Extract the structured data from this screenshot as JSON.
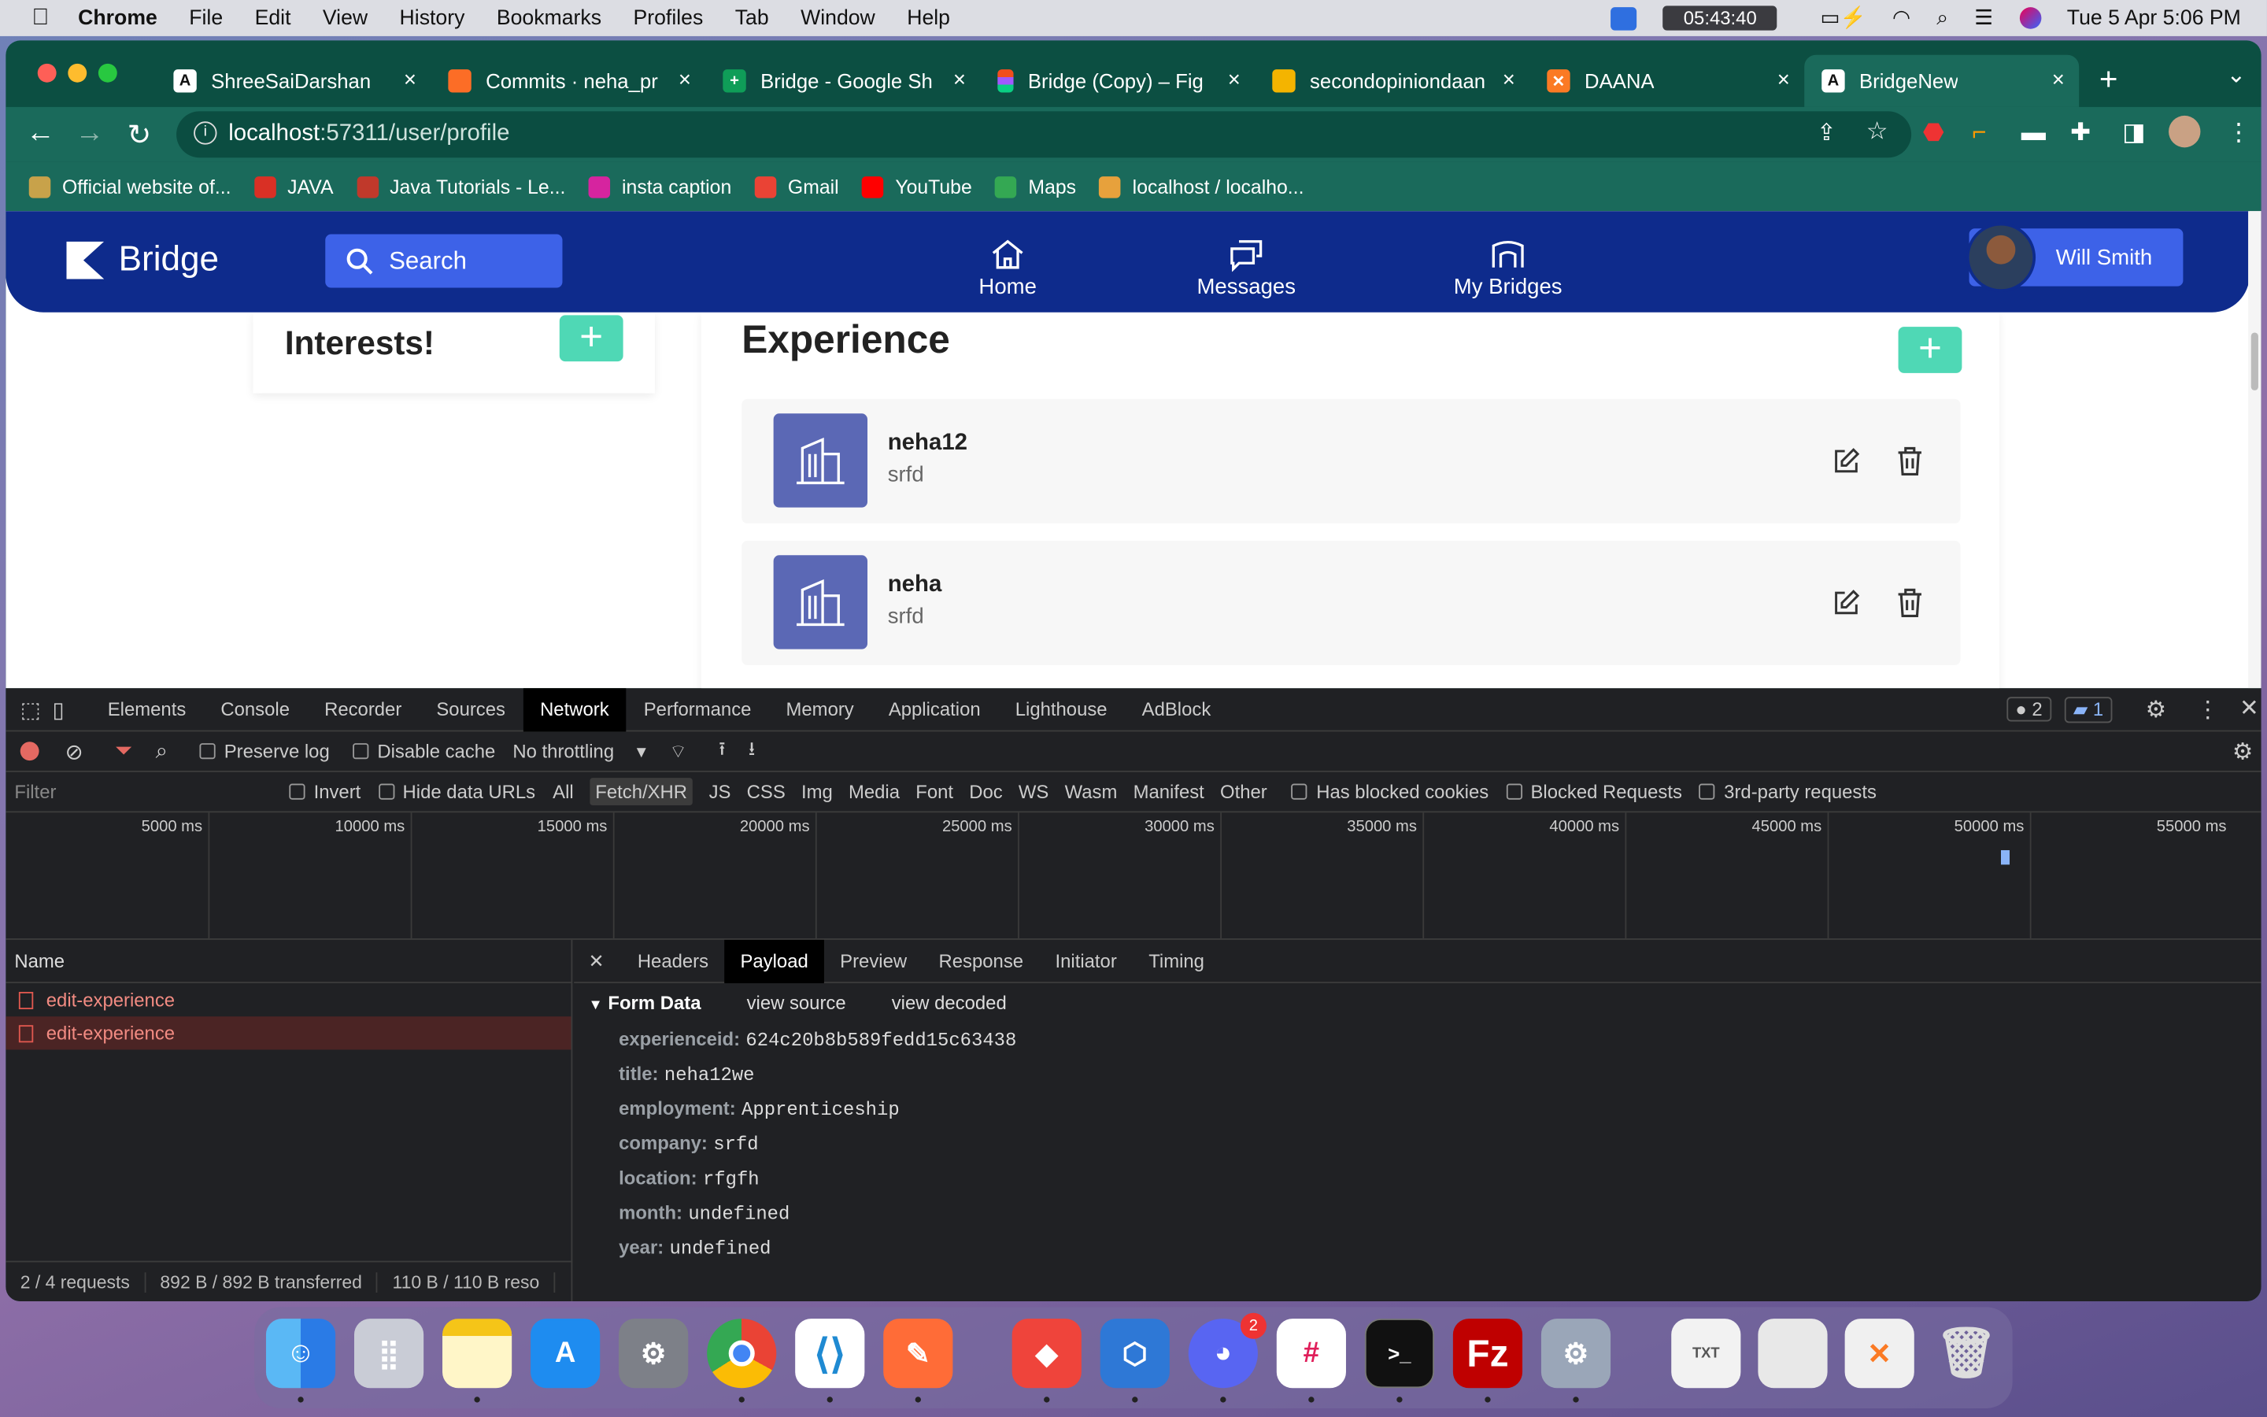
{
  "menubar": {
    "app": "Chrome",
    "items": [
      "File",
      "Edit",
      "View",
      "History",
      "Bookmarks",
      "Profiles",
      "Tab",
      "Window",
      "Help"
    ],
    "clock_badge": "05:43:40",
    "datetime": "Tue 5 Apr  5:06 PM"
  },
  "tabs": [
    {
      "title": "ShreeSaiDarshan",
      "icon": "angular-icon"
    },
    {
      "title": "Commits · neha_pr",
      "icon": "gitlab-icon"
    },
    {
      "title": "Bridge - Google Sh",
      "icon": "sheets-icon"
    },
    {
      "title": "Bridge (Copy) – Fig",
      "icon": "figma-icon"
    },
    {
      "title": "secondopiniondaan",
      "icon": "slides-icon"
    },
    {
      "title": "DAANA",
      "icon": "xampp-icon"
    },
    {
      "title": "BridgeNew",
      "icon": "angular-icon"
    }
  ],
  "address": {
    "host": "localhost",
    "path": ":57311/user/profile"
  },
  "bookmarks": [
    {
      "label": "Official website of...",
      "color": "#c8a24a"
    },
    {
      "label": "JAVA",
      "color": "#d93025"
    },
    {
      "label": "Java Tutorials - Le...",
      "color": "#c0392b"
    },
    {
      "label": "insta caption",
      "color": "#d6249f"
    },
    {
      "label": "Gmail",
      "color": "#ea4335"
    },
    {
      "label": "YouTube",
      "color": "#ff0000"
    },
    {
      "label": "Maps",
      "color": "#34a853"
    },
    {
      "label": "localhost / localho...",
      "color": "#e7a13c"
    }
  ],
  "app": {
    "brand": "Bridge",
    "search_label": "Search",
    "nav": {
      "home": "Home",
      "messages": "Messages",
      "my_bridges": "My Bridges"
    },
    "user_name": "Will Smith",
    "interests_title": "Interests!",
    "experience_title": "Experience",
    "experiences": [
      {
        "title": "neha12",
        "subtitle": "srfd"
      },
      {
        "title": "neha",
        "subtitle": "srfd"
      }
    ],
    "accent": "#4fd8b5",
    "header_color": "#0e2b8c"
  },
  "devtools": {
    "tabs": [
      "Elements",
      "Console",
      "Recorder",
      "Sources",
      "Network",
      "Performance",
      "Memory",
      "Application",
      "Lighthouse",
      "AdBlock"
    ],
    "active_tab": "Network",
    "issues_count": "2",
    "messages_count": "1",
    "bar": {
      "preserve_log": "Preserve log",
      "disable_cache": "Disable cache",
      "throttling": "No throttling"
    },
    "filter": {
      "placeholder": "Filter",
      "invert": "Invert",
      "hide_data_urls": "Hide data URLs",
      "types": [
        "All",
        "Fetch/XHR",
        "JS",
        "CSS",
        "Img",
        "Media",
        "Font",
        "Doc",
        "WS",
        "Wasm",
        "Manifest",
        "Other"
      ],
      "selected_type": "Fetch/XHR",
      "has_blocked_cookies": "Has blocked cookies",
      "blocked_requests": "Blocked Requests",
      "third_party": "3rd-party requests"
    },
    "timeline_ticks": [
      "5000 ms",
      "10000 ms",
      "15000 ms",
      "20000 ms",
      "25000 ms",
      "30000 ms",
      "35000 ms",
      "40000 ms",
      "45000 ms",
      "50000 ms",
      "55000 ms"
    ],
    "name_header": "Name",
    "requests": [
      "edit-experience",
      "edit-experience"
    ],
    "footer": {
      "requests": "2 / 4 requests",
      "transferred": "892 B / 892 B transferred",
      "resources": "110 B / 110 B reso"
    },
    "detail_tabs": [
      "Headers",
      "Payload",
      "Preview",
      "Response",
      "Initiator",
      "Timing"
    ],
    "detail_active": "Payload",
    "form_data": {
      "title": "Form Data",
      "view_source": "view source",
      "view_decoded": "view decoded",
      "fields": [
        {
          "key": "experienceid:",
          "value": "624c20b8b589fedd15c63438"
        },
        {
          "key": "title:",
          "value": "neha12we"
        },
        {
          "key": "employment:",
          "value": "Apprenticeship"
        },
        {
          "key": "company:",
          "value": "srfd"
        },
        {
          "key": "location:",
          "value": "rfgfh"
        },
        {
          "key": "month:",
          "value": "undefined"
        },
        {
          "key": "year:",
          "value": "undefined"
        }
      ]
    }
  },
  "dock": {
    "discord_badge": "2",
    "apps": [
      "finder-icon",
      "launchpad-icon",
      "notes-icon",
      "app-store-icon",
      "system-preferences-icon",
      "chrome-icon",
      "vscode-icon",
      "postman-icon",
      "anydesk-icon",
      "pulse-icon",
      "discord-icon",
      "slack-icon",
      "terminal-icon",
      "filezilla-icon",
      "settings-icon",
      "document-icon",
      "spreadsheet-icon",
      "xampp-icon",
      "trash-icon"
    ]
  }
}
